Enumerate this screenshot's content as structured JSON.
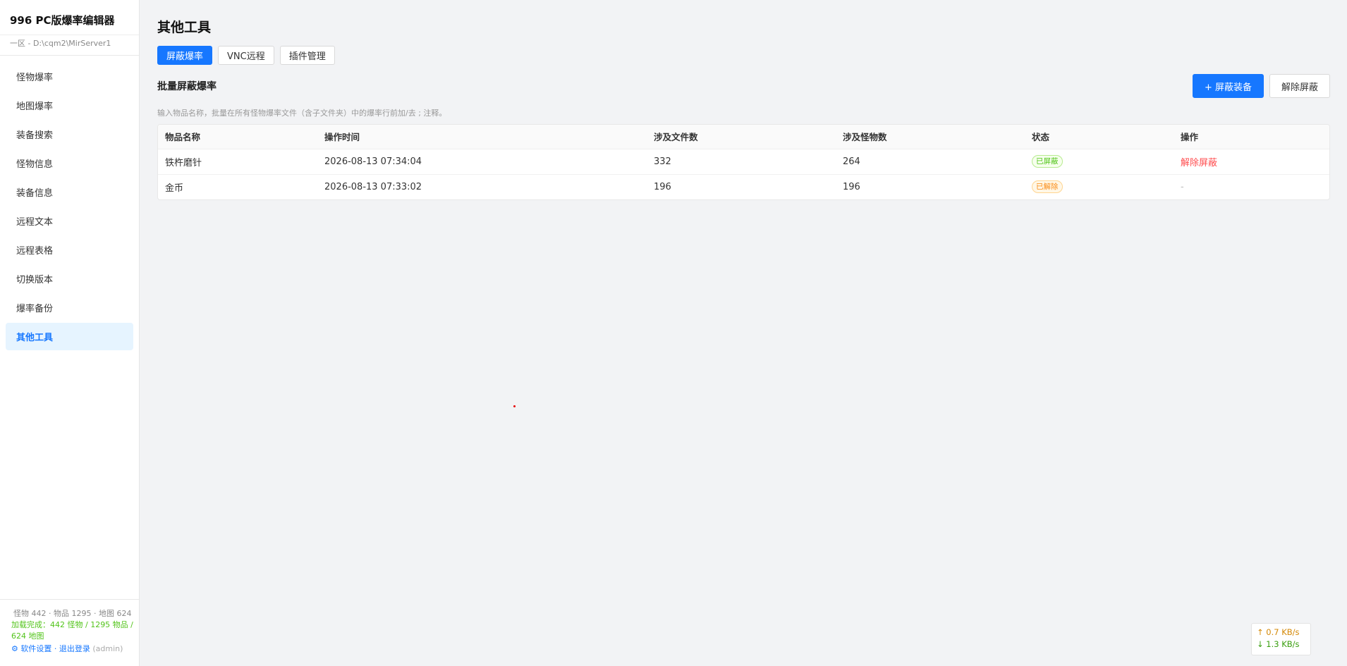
{
  "app": {
    "title": "996 PC版爆率编辑器",
    "server_path": "一区 - D:\\cqm2\\MirServer1"
  },
  "sidebar": {
    "items": [
      {
        "label": "怪物爆率"
      },
      {
        "label": "地图爆率"
      },
      {
        "label": "装备搜索"
      },
      {
        "label": "怪物信息"
      },
      {
        "label": "装备信息"
      },
      {
        "label": "远程文本"
      },
      {
        "label": "远程表格"
      },
      {
        "label": "切换版本"
      },
      {
        "label": "爆率备份"
      },
      {
        "label": "其他工具"
      }
    ],
    "active_index": 9,
    "footer": {
      "stats": "怪物 442 · 物品 1295 · 地图 624",
      "loaded": "加载完成：442 怪物 / 1295 物品 / 624 地图",
      "settings_icon": "gear-icon",
      "settings_label": "软件设置",
      "separator": "·",
      "logout_label": "退出登录",
      "user": "(admin)"
    }
  },
  "main": {
    "page_title": "其他工具",
    "tabs": [
      {
        "label": "屏蔽爆率"
      },
      {
        "label": "VNC远程"
      },
      {
        "label": "插件管理"
      }
    ],
    "active_tab": 0,
    "section": {
      "title": "批量屏蔽爆率",
      "add_button": "+ 屏蔽装备",
      "remove_button": "解除屏蔽",
      "hint": "输入物品名称，批量在所有怪物爆率文件（含子文件夹）中的爆率行前加/去 ; 注释。"
    },
    "table": {
      "headers": [
        "物品名称",
        "操作时间",
        "涉及文件数",
        "涉及怪物数",
        "状态",
        "操作"
      ],
      "rows": [
        {
          "name": "铁杵磨针",
          "time": "2026-08-13 07:34:04",
          "files": "332",
          "monsters": "264",
          "status": "已屏蔽",
          "status_color": "#52c41a",
          "action": "解除屏蔽"
        },
        {
          "name": "金币",
          "time": "2026-08-13 07:33:02",
          "files": "196",
          "monsters": "196",
          "status": "已解除",
          "status_color": "#fa8c16",
          "action": "-"
        }
      ]
    }
  },
  "network": {
    "up": "↑ 0.7 KB/s",
    "down": "↓ 1.3 KB/s"
  },
  "colors": {
    "accent": "#1677ff",
    "danger": "#ff4d4f",
    "success": "#52c41a",
    "warning": "#fa8c16"
  }
}
